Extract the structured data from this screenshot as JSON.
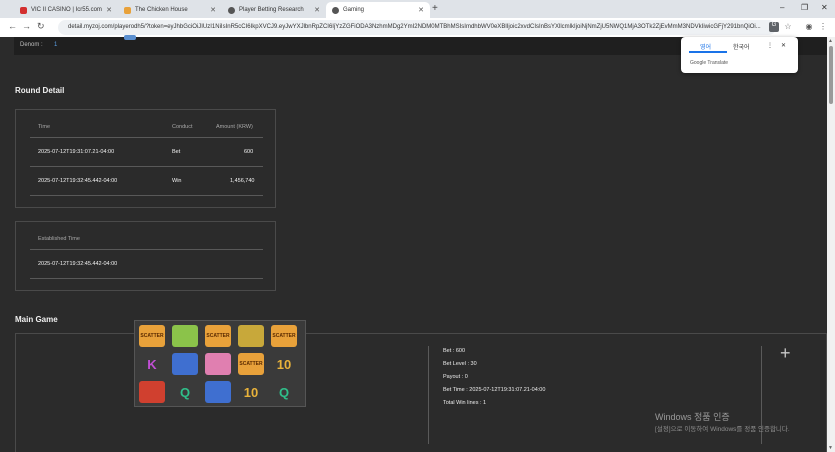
{
  "tabs": [
    {
      "label": "VIC II CASINO | Icr55.com",
      "color": "#d32f2f"
    },
    {
      "label": "The Chicken House",
      "color": "#e8a13a"
    },
    {
      "label": "Player Betting Research",
      "color": "#555555"
    },
    {
      "label": "Gaming",
      "color": "#555555"
    }
  ],
  "address_bar": {
    "url": "detail.myzoj.com/playerodh5/?token=eyJhbGciOiJIUzI1NiIsInR5cCI6IkpXVCJ9.eyJwYXJlbnRpZCI6IjYzZGFiODA3NzhmMDg2YmI2NDM0MTBhMSIsImdhbWV0eXBlIjoic2xvdCIsInBsYXllcmlkIjoiNjNmZjU5NWQ1MjA3OTk2ZjEvMmM3NDVkIiwicGFjY291bnQiOi..."
  },
  "denom": {
    "label": "Denom :",
    "value": "1"
  },
  "round_detail": {
    "title": "Round Detail",
    "headers": {
      "time": "Time",
      "conduct": "Conduct",
      "amount": "Amount (KRW)"
    },
    "rows": [
      {
        "time": "2025-07-12T19:31:07.21-04:00",
        "conduct": "Bet",
        "amount": "600"
      },
      {
        "time": "2025-07-12T19:32:45.442-04:00",
        "conduct": "Win",
        "amount": "1,456,740"
      }
    ]
  },
  "established": {
    "header": "Established Time",
    "value": "2025-07-12T19:32:45.442-04:00"
  },
  "main_game": {
    "title": "Main Game",
    "info": {
      "bet": "Bet : 600",
      "bet_level": "Bet Level : 30",
      "payout": "Payout : 0",
      "bet_time": "Bet Time : 2025-07-12T19:31:07.21-04:00",
      "total_win_lines": "Total Win lines : 1"
    },
    "reels": [
      [
        {
          "t": "SCATTER",
          "c": "#e8a13a"
        },
        {
          "t": "",
          "c": "#8bc34a"
        },
        {
          "t": "SCATTER",
          "c": "#e8a13a"
        },
        {
          "t": "",
          "c": "#c8a83a"
        },
        {
          "t": "SCATTER",
          "c": "#e8a13a"
        }
      ],
      [
        {
          "t": "K",
          "c": "#c24fd6"
        },
        {
          "t": "",
          "c": "#3f6fd0"
        },
        {
          "t": "",
          "c": "#e07fb0"
        },
        {
          "t": "SCATTER",
          "c": "#e8a13a"
        },
        {
          "t": "10",
          "c": "#e8b23a"
        }
      ],
      [
        {
          "t": "",
          "c": "#d0402f"
        },
        {
          "t": "Q",
          "c": "#2fbf8a"
        },
        {
          "t": "",
          "c": "#3f6fd0"
        },
        {
          "t": "10",
          "c": "#e8b23a"
        },
        {
          "t": "Q",
          "c": "#2fbf8a"
        }
      ]
    ]
  },
  "translate": {
    "lang1": "영어",
    "lang2": "한국어",
    "brand": "Google Translate"
  },
  "watermark": {
    "line1": "Windows 정품 인증",
    "line2": "[설정]으로 이동하여 Windows를 정품 인증합니다."
  },
  "colors": {
    "page_bg": "#2b2b2b",
    "accent": "#1a73e8"
  }
}
